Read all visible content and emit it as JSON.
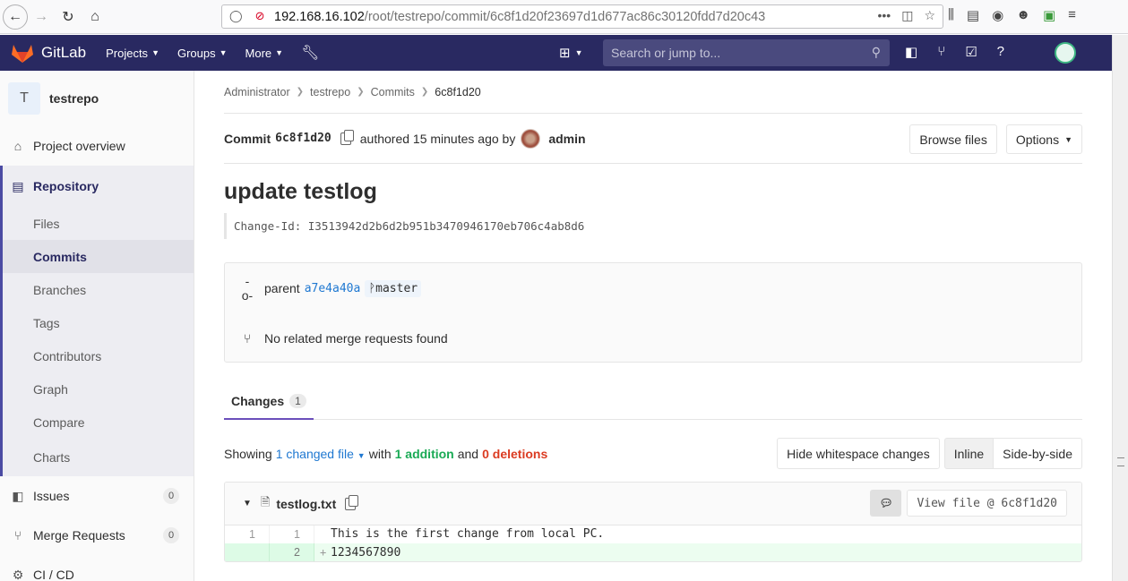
{
  "browser": {
    "url_host": "192.168.16.102",
    "url_path": "/root/testrepo/commit/6c8f1d20f23697d1d677ac86c30120fdd7d20c43",
    "more_glyph": "•••"
  },
  "navbar": {
    "brand": "GitLab",
    "menus": [
      "Projects",
      "Groups",
      "More"
    ],
    "search_placeholder": "Search or jump to..."
  },
  "sidebar": {
    "project_initial": "T",
    "project_name": "testrepo",
    "overview": "Project overview",
    "repository": "Repository",
    "repo_items": [
      "Files",
      "Commits",
      "Branches",
      "Tags",
      "Contributors",
      "Graph",
      "Compare",
      "Charts"
    ],
    "issues": "Issues",
    "issues_count": "0",
    "merge_requests": "Merge Requests",
    "mr_count": "0",
    "cicd": "CI / CD"
  },
  "breadcrumbs": [
    "Administrator",
    "testrepo",
    "Commits",
    "6c8f1d20"
  ],
  "commit": {
    "label": "Commit",
    "sha": "6c8f1d20",
    "authored": "authored 15 minutes ago by",
    "author": "admin",
    "browse_files": "Browse files",
    "options": "Options",
    "title": "update testlog",
    "description": "Change-Id: I3513942d2b6d2b951b3470946170eb706c4ab8d6",
    "parent_label": "parent",
    "parent_sha": "a7e4a40a",
    "branch": "master",
    "no_mr": "No related merge requests found"
  },
  "tabs": {
    "changes": "Changes",
    "changes_count": "1"
  },
  "changes": {
    "showing": "Showing",
    "changed_file": "1 changed file",
    "with": "with",
    "additions": "1 addition",
    "and": "and",
    "deletions": "0 deletions",
    "hide_whitespace": "Hide whitespace changes",
    "inline": "Inline",
    "side_by_side": "Side-by-side"
  },
  "file": {
    "name": "testlog.txt",
    "view_file": "View file @ 6c8f1d20",
    "lines": [
      {
        "old": "1",
        "new": "1",
        "marker": "",
        "text": "This is the first change from local PC."
      },
      {
        "old": "",
        "new": "2",
        "marker": "+",
        "text": "1234567890"
      }
    ]
  },
  "colors": {
    "nav_bg": "#292961",
    "addition": "#1aaa55",
    "deletion": "#db3b21",
    "link": "#1f78d1",
    "tab_underline": "#6b4fbb"
  }
}
